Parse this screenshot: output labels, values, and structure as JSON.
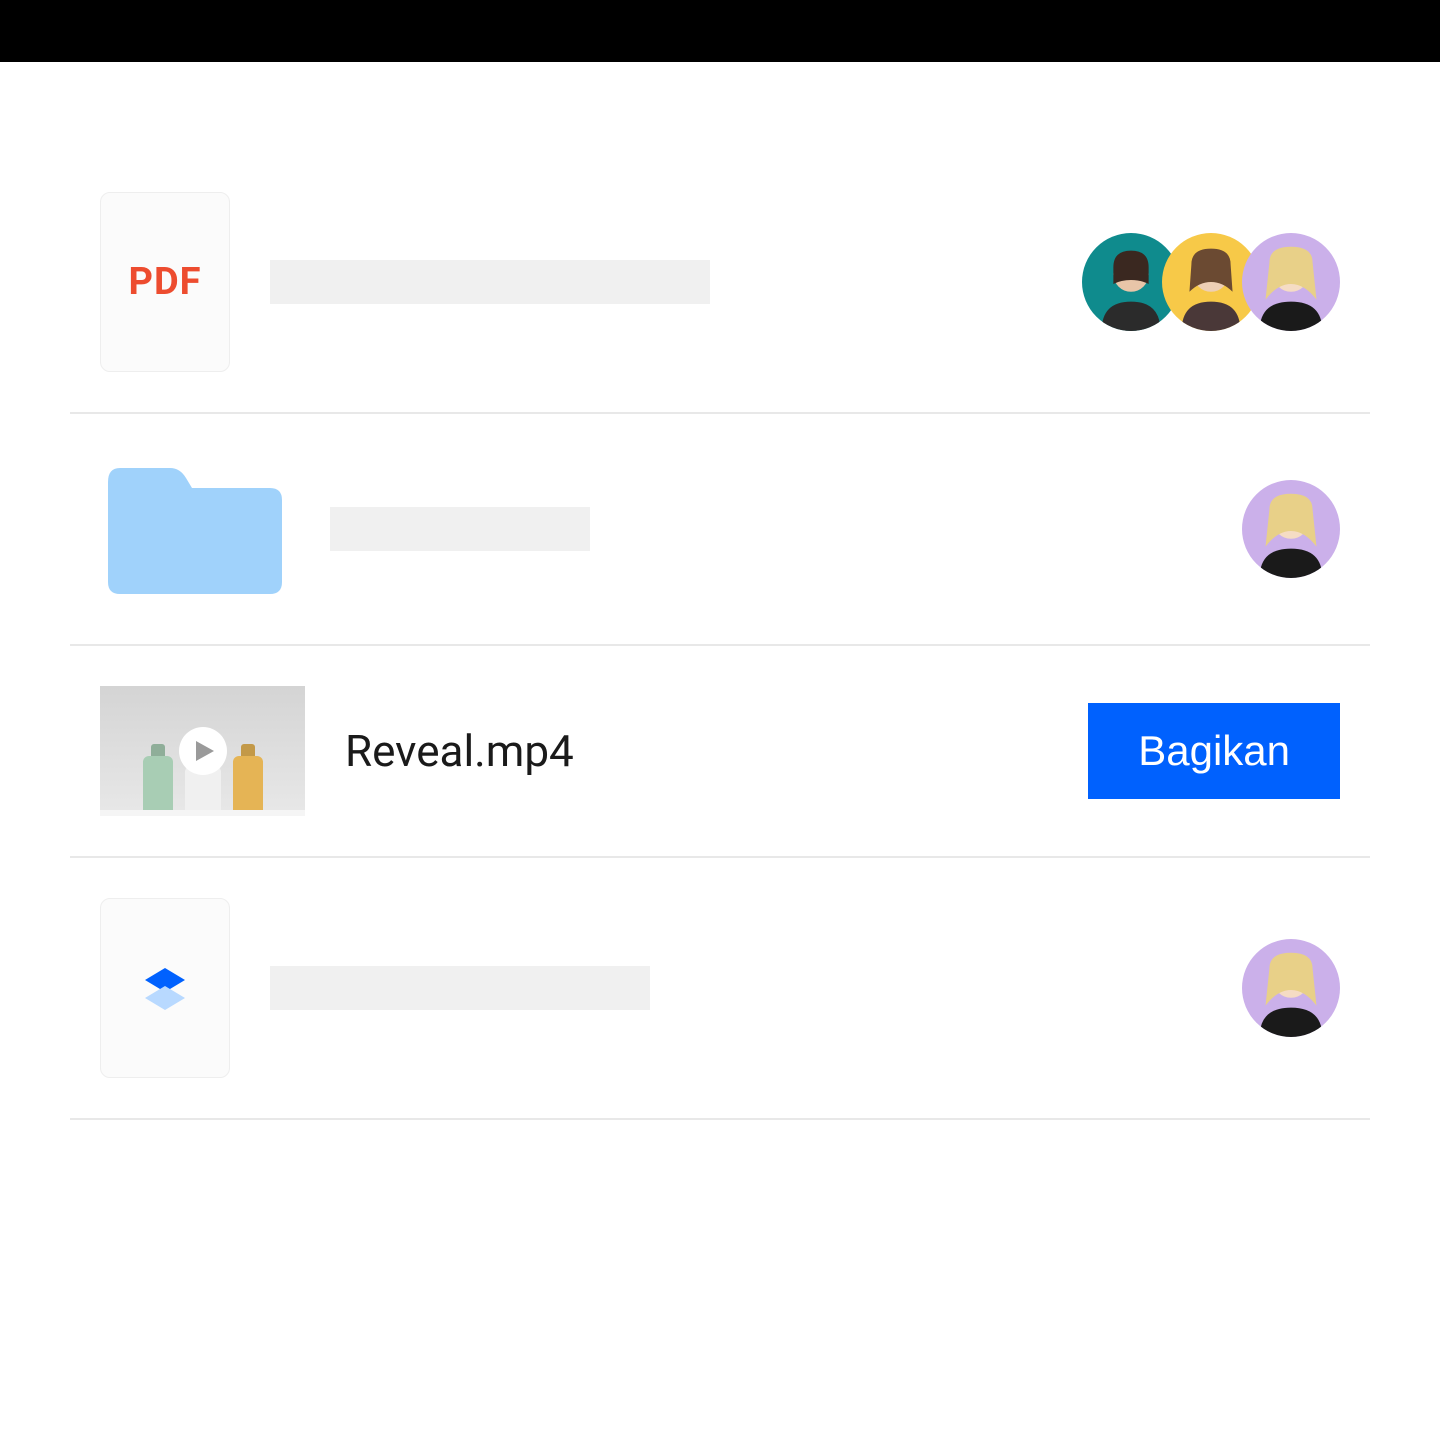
{
  "rows": [
    {
      "type": "pdf",
      "iconLabel": "PDF",
      "collaborators": [
        {
          "bg": "teal"
        },
        {
          "bg": "yellow"
        },
        {
          "bg": "lilac"
        }
      ]
    },
    {
      "type": "folder",
      "collaborators": [
        {
          "bg": "lilac"
        }
      ]
    },
    {
      "type": "video",
      "name": "Reveal.mp4",
      "shareLabel": "Bagikan"
    },
    {
      "type": "paper",
      "collaborators": [
        {
          "bg": "lilac"
        }
      ]
    }
  ],
  "colors": {
    "accent": "#0061fe",
    "pdfRed": "#ed4c2f",
    "folderBlue": "#a0d2fb"
  }
}
